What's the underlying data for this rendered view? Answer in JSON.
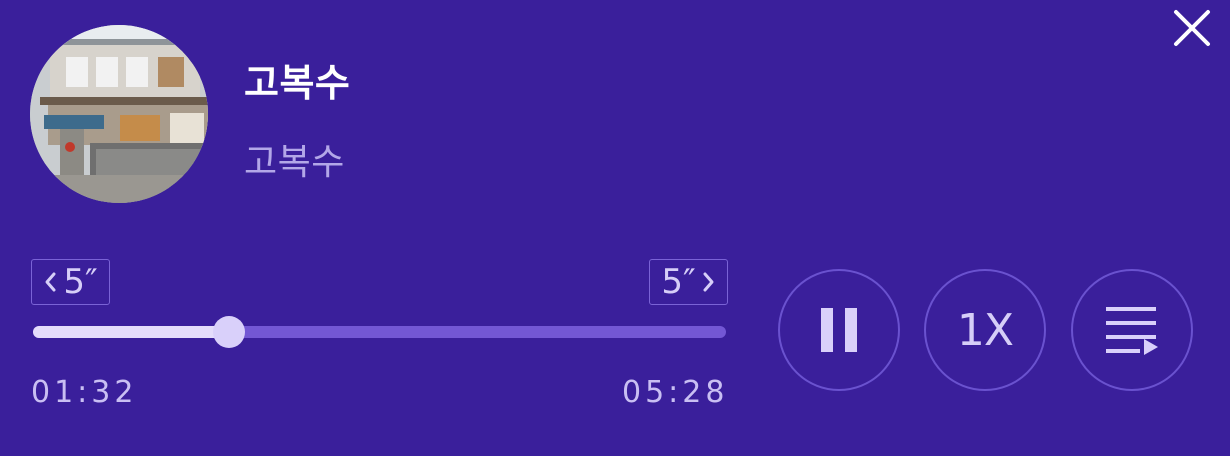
{
  "track": {
    "title": "고복수",
    "artist": "고복수",
    "album_art_icon": "building-photo"
  },
  "controls": {
    "close_icon": "close-icon",
    "skip_back_label": "5″",
    "skip_forward_label": "5″",
    "speed_label": "1X",
    "pause_icon": "pause-icon",
    "playlist_icon": "playlist-play-icon"
  },
  "progress": {
    "current_time": "01:32",
    "total_time": "05:28",
    "fraction": 0.283
  },
  "colors": {
    "background": "#3a1f9b",
    "accent": "#d9d0fa",
    "track": "#7357d4"
  }
}
